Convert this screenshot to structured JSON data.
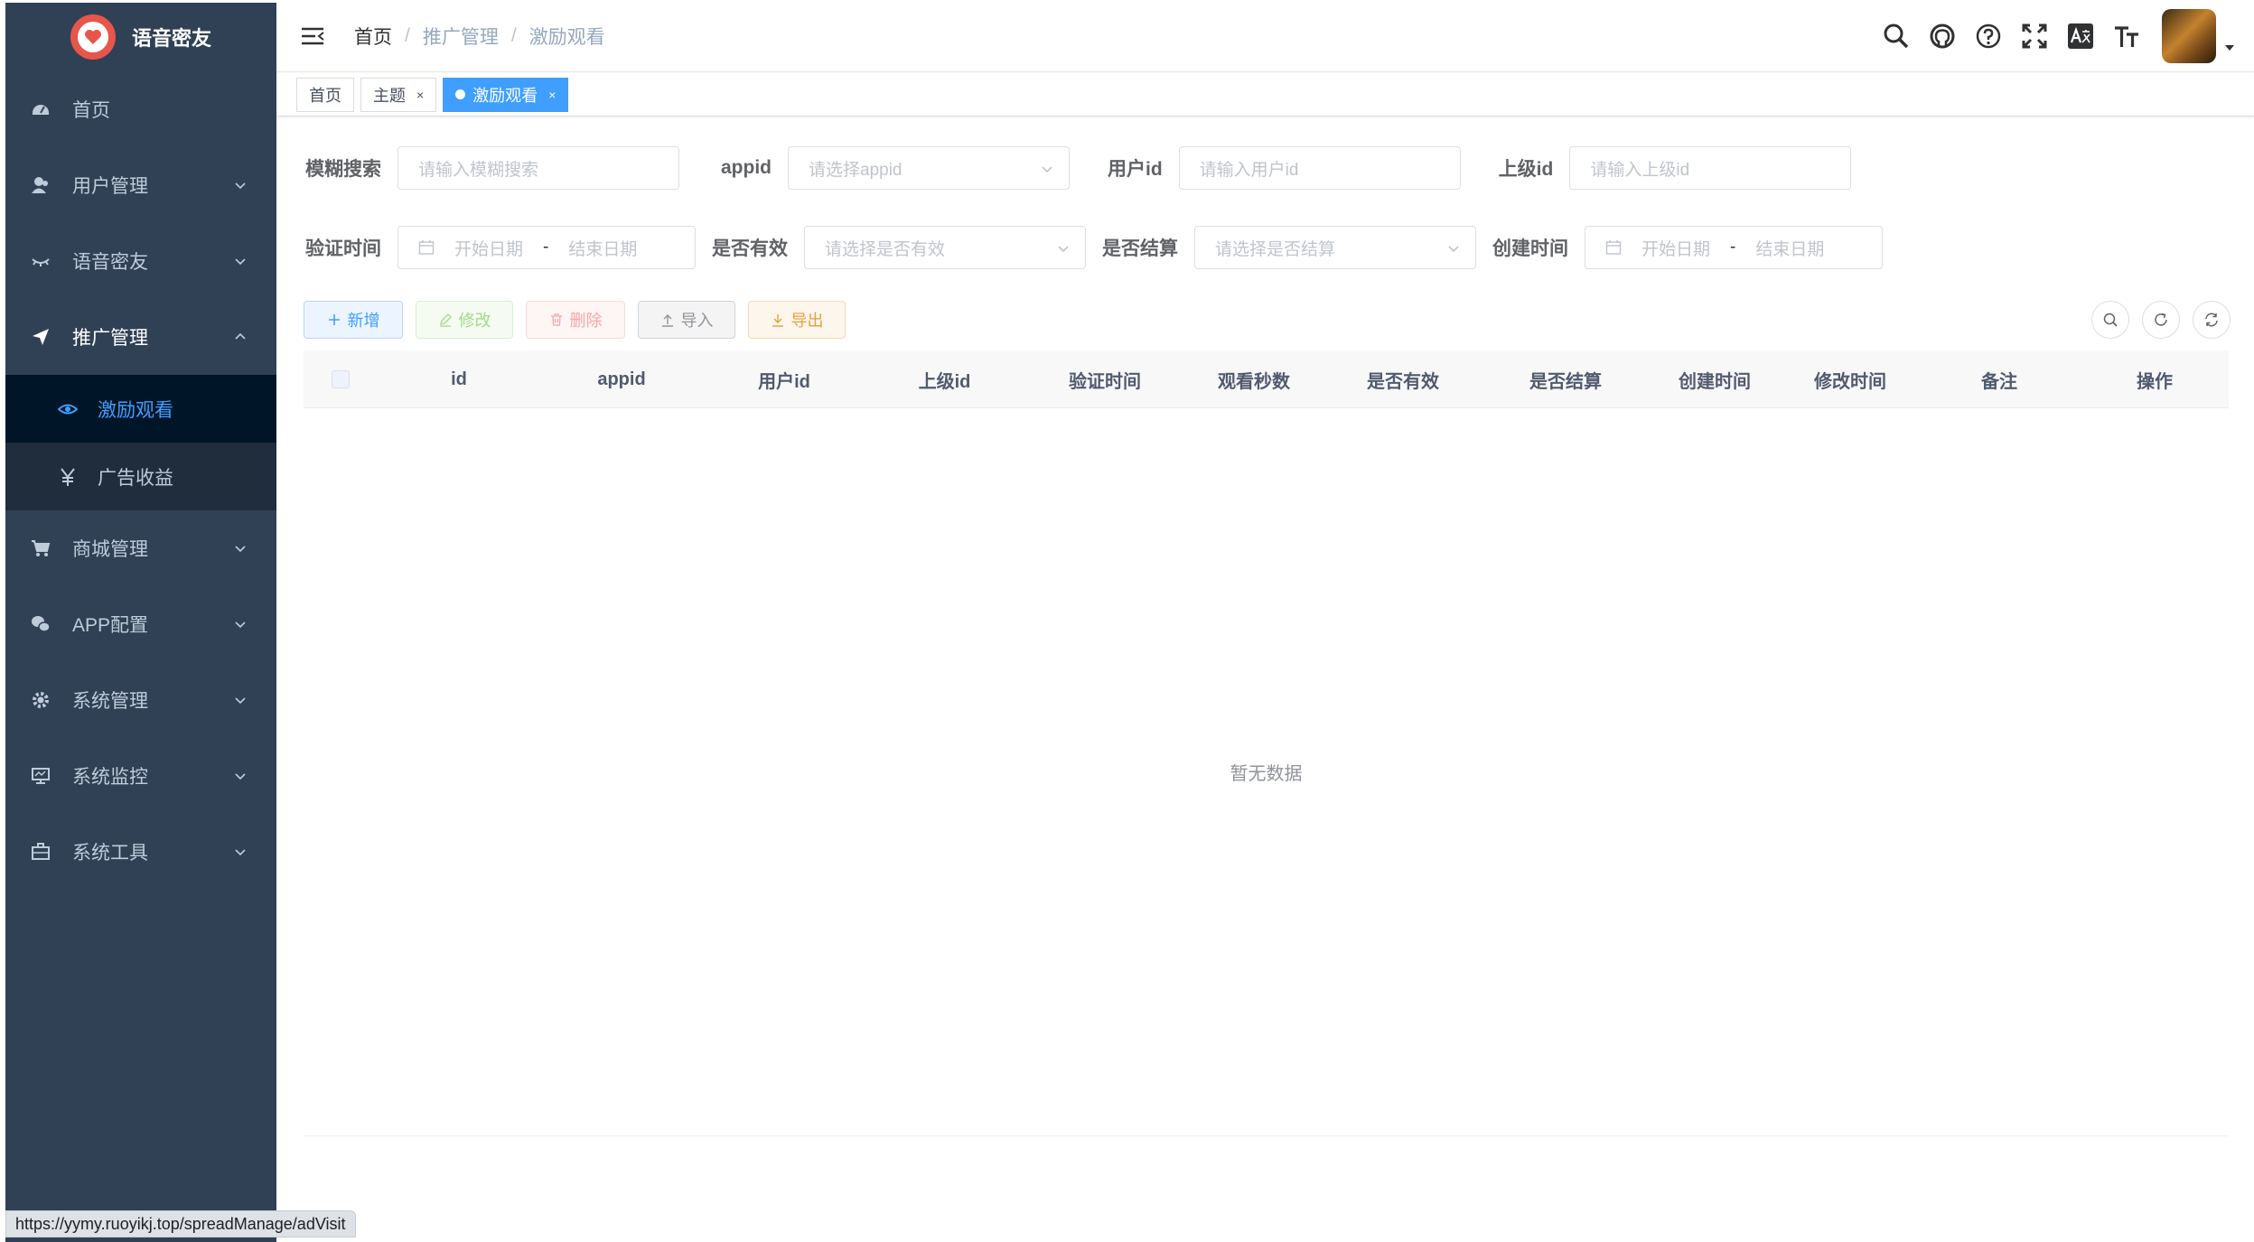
{
  "app": {
    "title": "语音密友"
  },
  "sidebar": {
    "items": [
      {
        "label": "首页",
        "icon": "dashboard-icon"
      },
      {
        "label": "用户管理",
        "icon": "user-icon"
      },
      {
        "label": "语音密友",
        "icon": "eye-closed-icon"
      },
      {
        "label": "推广管理",
        "icon": "paper-plane-icon"
      },
      {
        "label": "商城管理",
        "icon": "cart-icon"
      },
      {
        "label": "APP配置",
        "icon": "wechat-icon"
      },
      {
        "label": "系统管理",
        "icon": "gear-icon"
      },
      {
        "label": "系统监控",
        "icon": "monitor-icon"
      },
      {
        "label": "系统工具",
        "icon": "toolbox-icon"
      }
    ],
    "submenu": [
      {
        "label": "激励观看",
        "icon": "eye-icon",
        "active": true
      },
      {
        "label": "广告收益",
        "icon": "yen-icon",
        "active": false
      }
    ]
  },
  "breadcrumb": [
    "首页",
    "推广管理",
    "激励观看"
  ],
  "tags": [
    {
      "label": "首页"
    },
    {
      "label": "主题",
      "close": "×"
    },
    {
      "label": "激励观看",
      "close": "×",
      "active": true
    }
  ],
  "search": {
    "fuzzy": {
      "label": "模糊搜索",
      "placeholder": "请输入模糊搜索"
    },
    "appid": {
      "label": "appid",
      "placeholder": "请选择appid"
    },
    "userid": {
      "label": "用户id",
      "placeholder": "请输入用户id"
    },
    "parentid": {
      "label": "上级id",
      "placeholder": "请输入上级id"
    },
    "verify_time": {
      "label": "验证时间",
      "start": "开始日期",
      "sep": "-",
      "end": "结束日期"
    },
    "valid": {
      "label": "是否有效",
      "placeholder": "请选择是否有效"
    },
    "settled": {
      "label": "是否结算",
      "placeholder": "请选择是否结算"
    },
    "create_time": {
      "label": "创建时间",
      "start": "开始日期",
      "sep": "-",
      "end": "结束日期"
    }
  },
  "toolbar": {
    "add": "新增",
    "edit": "修改",
    "delete": "删除",
    "import": "导入",
    "export": "导出"
  },
  "table": {
    "columns": [
      "id",
      "appid",
      "用户id",
      "上级id",
      "验证时间",
      "观看秒数",
      "是否有效",
      "是否结算",
      "创建时间",
      "修改时间",
      "备注",
      "操作"
    ],
    "empty_text": "暂无数据"
  },
  "status_url": "https://yymy.ruoyikj.top/spreadManage/adVisit",
  "colors": {
    "sidebar_bg": "#304156",
    "submenu_bg": "#1f2d3d",
    "active_text": "#409eff",
    "active_tag": "#409eff"
  }
}
